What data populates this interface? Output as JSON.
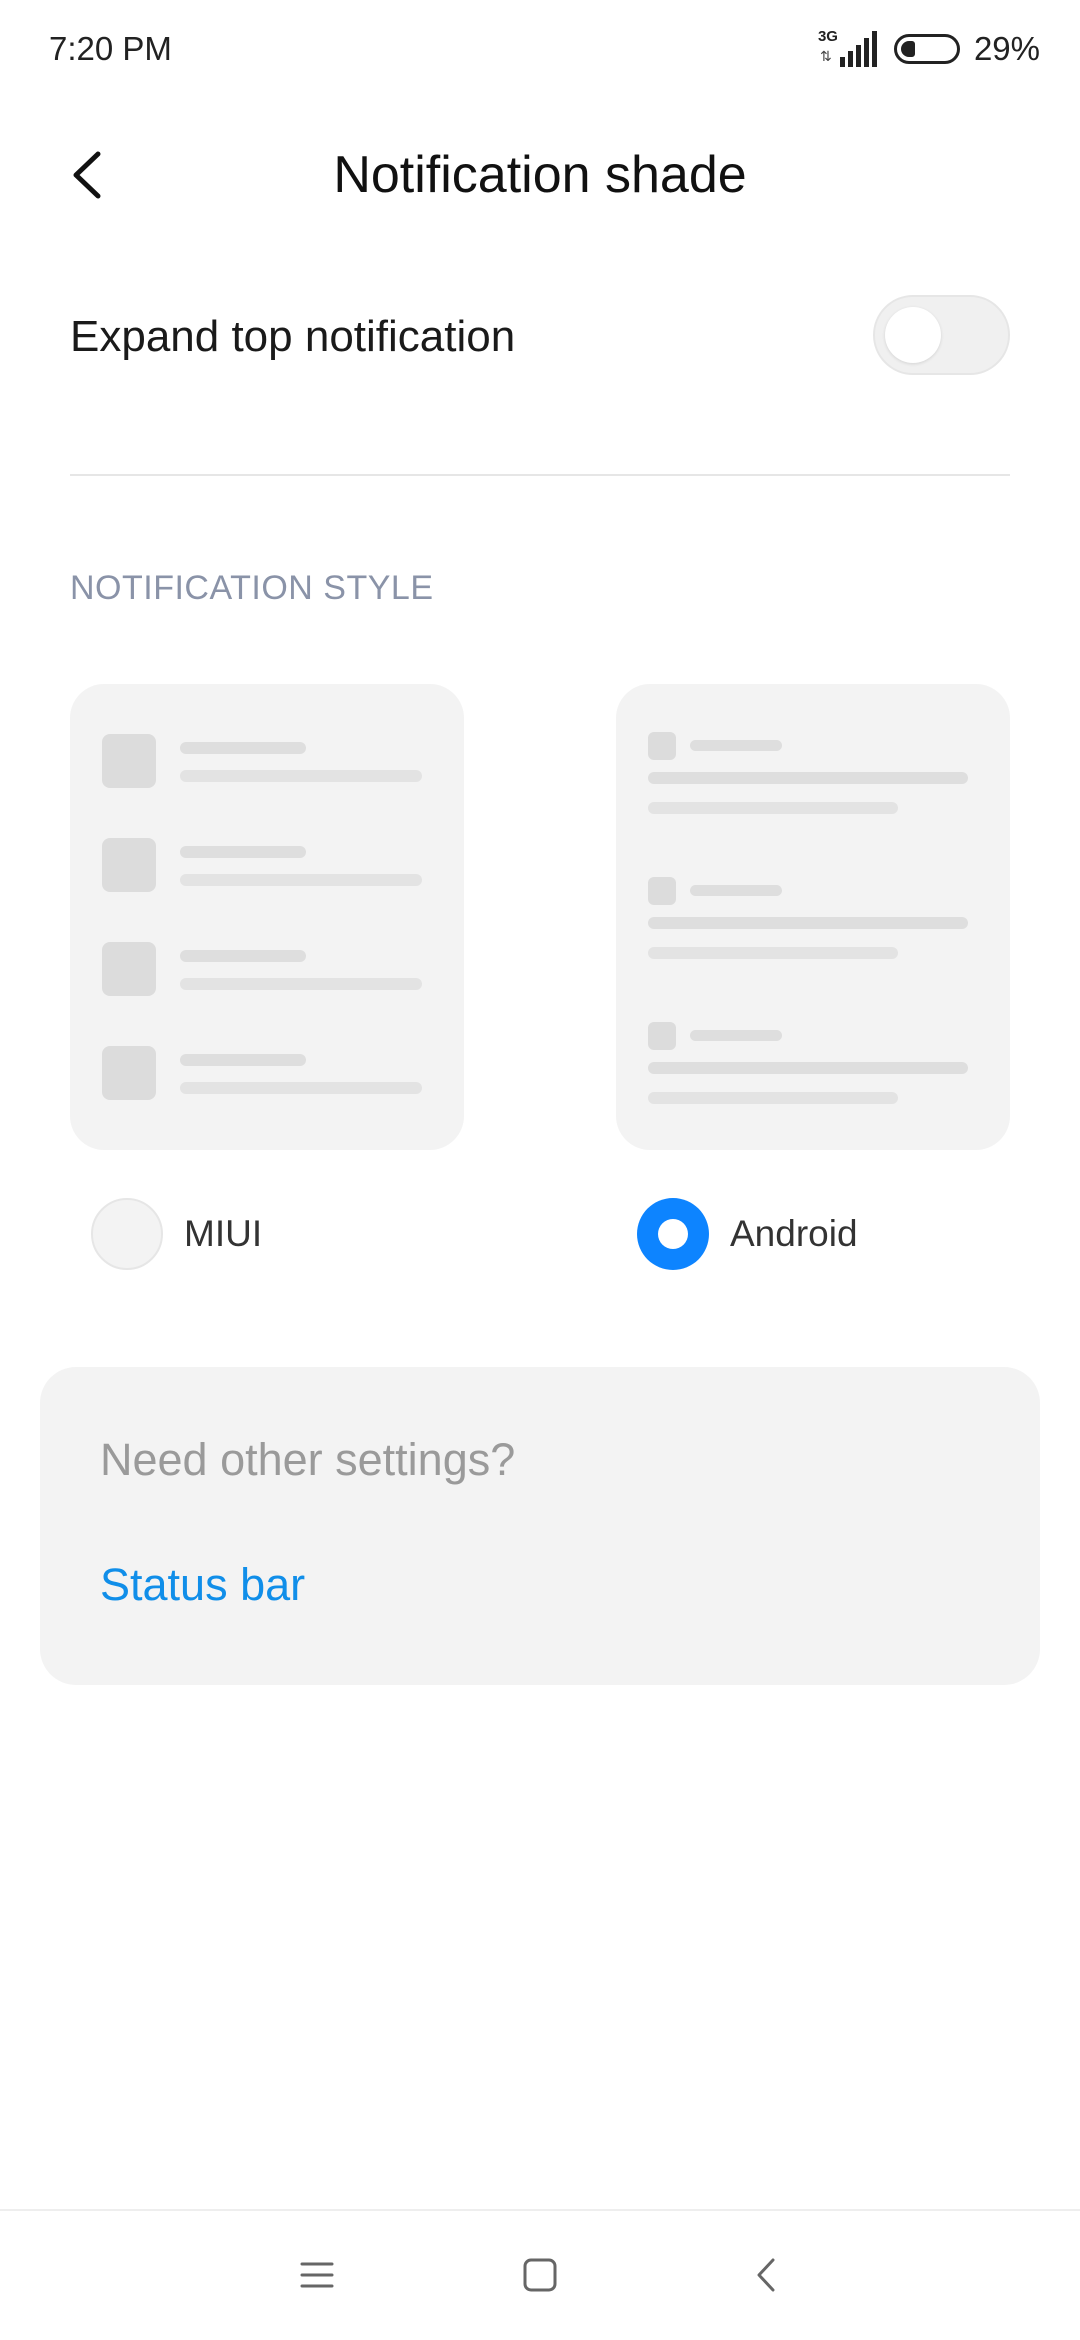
{
  "status_bar": {
    "time": "7:20 PM",
    "network_type": "3G",
    "battery_percent": "29%"
  },
  "header": {
    "title": "Notification shade",
    "back_icon": "chevron-left-icon"
  },
  "expand_top_notification": {
    "label": "Expand top notification",
    "enabled": false
  },
  "notification_style": {
    "header": "NOTIFICATION STYLE",
    "options": [
      {
        "label": "MIUI",
        "selected": false
      },
      {
        "label": "Android",
        "selected": true
      }
    ]
  },
  "other_settings": {
    "prompt": "Need other settings?",
    "link": "Status bar"
  },
  "navigation": {
    "menu_icon": "menu-icon",
    "home_icon": "home-square-icon",
    "back_icon": "back-chevron-icon"
  },
  "colors": {
    "accent": "#108ee9",
    "radio_selected": "#0d84ff",
    "section_header": "#8a93a8"
  }
}
